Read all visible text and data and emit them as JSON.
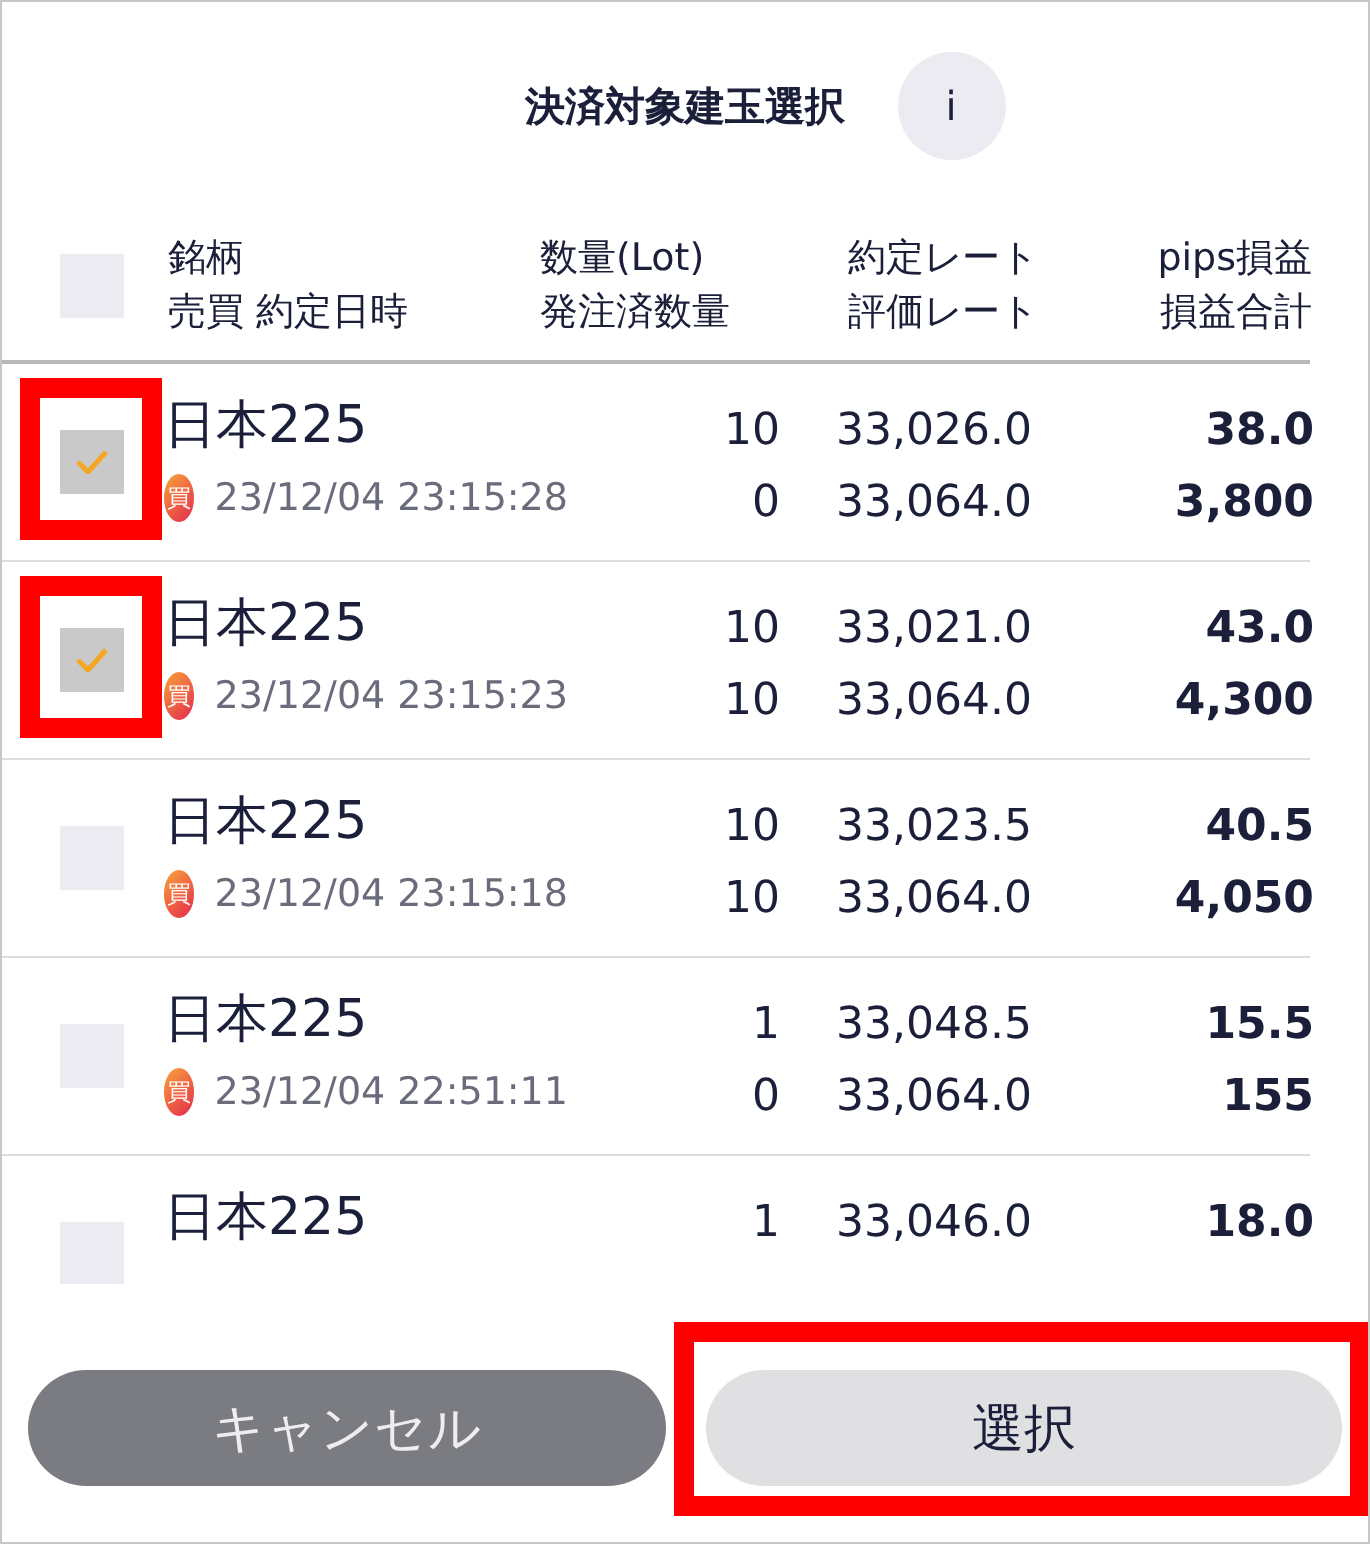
{
  "title": "決済対象建玉選択",
  "info_button": "i",
  "header": {
    "select_all": {
      "checked": false
    },
    "columns": [
      [
        "銘柄",
        "売買 約定日時"
      ],
      [
        "数量(Lot)",
        "発注済数量"
      ],
      [
        "約定レート",
        "評価レート"
      ],
      [
        "pips損益",
        "損益合計"
      ]
    ]
  },
  "rows": [
    {
      "checked": true,
      "highlighted": true,
      "symbol": "日本225",
      "side": "買",
      "datetime": "23/12/04 23:15:28",
      "qty": "10",
      "ordered_qty": "0",
      "contract_rate": "33,026.0",
      "valuation_rate": "33,064.0",
      "pips": "38.0",
      "pnl": "3,800"
    },
    {
      "checked": true,
      "highlighted": true,
      "symbol": "日本225",
      "side": "買",
      "datetime": "23/12/04 23:15:23",
      "qty": "10",
      "ordered_qty": "10",
      "contract_rate": "33,021.0",
      "valuation_rate": "33,064.0",
      "pips": "43.0",
      "pnl": "4,300"
    },
    {
      "checked": false,
      "highlighted": false,
      "symbol": "日本225",
      "side": "買",
      "datetime": "23/12/04 23:15:18",
      "qty": "10",
      "ordered_qty": "10",
      "contract_rate": "33,023.5",
      "valuation_rate": "33,064.0",
      "pips": "40.5",
      "pnl": "4,050"
    },
    {
      "checked": false,
      "highlighted": false,
      "symbol": "日本225",
      "side": "買",
      "datetime": "23/12/04 22:51:11",
      "qty": "1",
      "ordered_qty": "0",
      "contract_rate": "33,048.5",
      "valuation_rate": "33,064.0",
      "pips": "15.5",
      "pnl": "155"
    },
    {
      "checked": false,
      "highlighted": false,
      "symbol": "日本225",
      "qty": "1",
      "contract_rate": "33,046.0",
      "pips": "18.0"
    }
  ],
  "buttons": [
    {
      "label": "キャンセル",
      "kind": "cancel",
      "highlighted": false
    },
    {
      "label": "選択",
      "kind": "confirm",
      "highlighted": true
    }
  ]
}
